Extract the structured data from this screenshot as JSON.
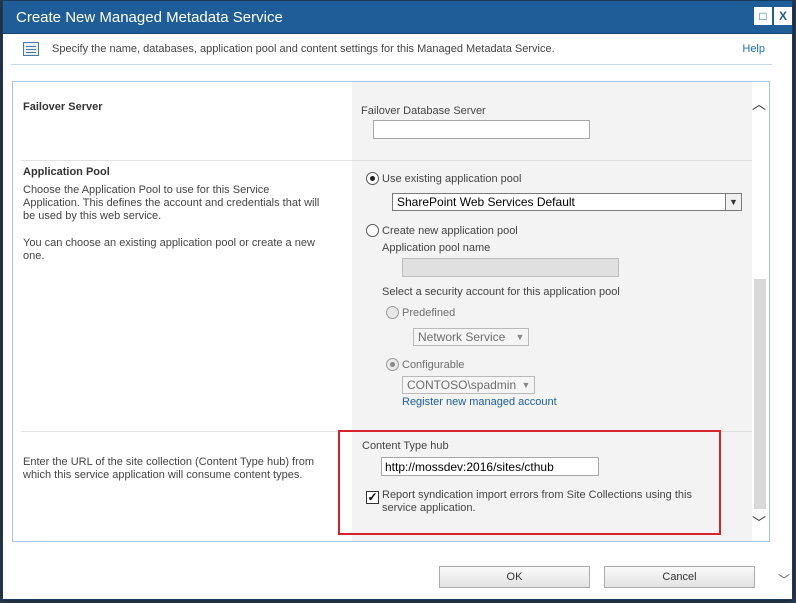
{
  "window": {
    "title": "Create New Managed Metadata Service",
    "restore_label": "□",
    "close_label": "X"
  },
  "infobar": {
    "text": "Specify the name, databases, application pool and content settings for this Managed Metadata Service.",
    "help": "Help"
  },
  "failover": {
    "heading": "Failover Server",
    "field_label": "Failover Database Server",
    "field_value": ""
  },
  "app_pool": {
    "heading": "Application Pool",
    "desc1": "Choose the Application Pool to use for this Service Application. This defines the account and credentials that will be used by this web service.",
    "desc2": "You can choose an existing application pool or create a new one.",
    "use_existing_label": "Use existing application pool",
    "existing_selected": "SharePoint Web Services Default",
    "create_new_label": "Create new application pool",
    "pool_name_label": "Application pool name",
    "pool_name_value": "",
    "security_label": "Select a security account for this application pool",
    "predefined_label": "Predefined",
    "predefined_selected": "Network Service",
    "configurable_label": "Configurable",
    "configurable_selected": "CONTOSO\\spadmin",
    "register_link": "Register new managed account"
  },
  "content_type": {
    "desc": "Enter the URL of the site collection (Content Type hub) from which this service application will consume content types.",
    "hub_label": "Content Type hub",
    "hub_value": "http://mossdev:2016/sites/cthub",
    "report_errors_label": "Report syndication import errors from Site Collections using this service application.",
    "report_errors_checked": true
  },
  "buttons": {
    "ok": "OK",
    "cancel": "Cancel"
  },
  "colors": {
    "titlebar": "#1e5d97",
    "highlight": "#d7232b",
    "link": "#1c5fa0"
  }
}
